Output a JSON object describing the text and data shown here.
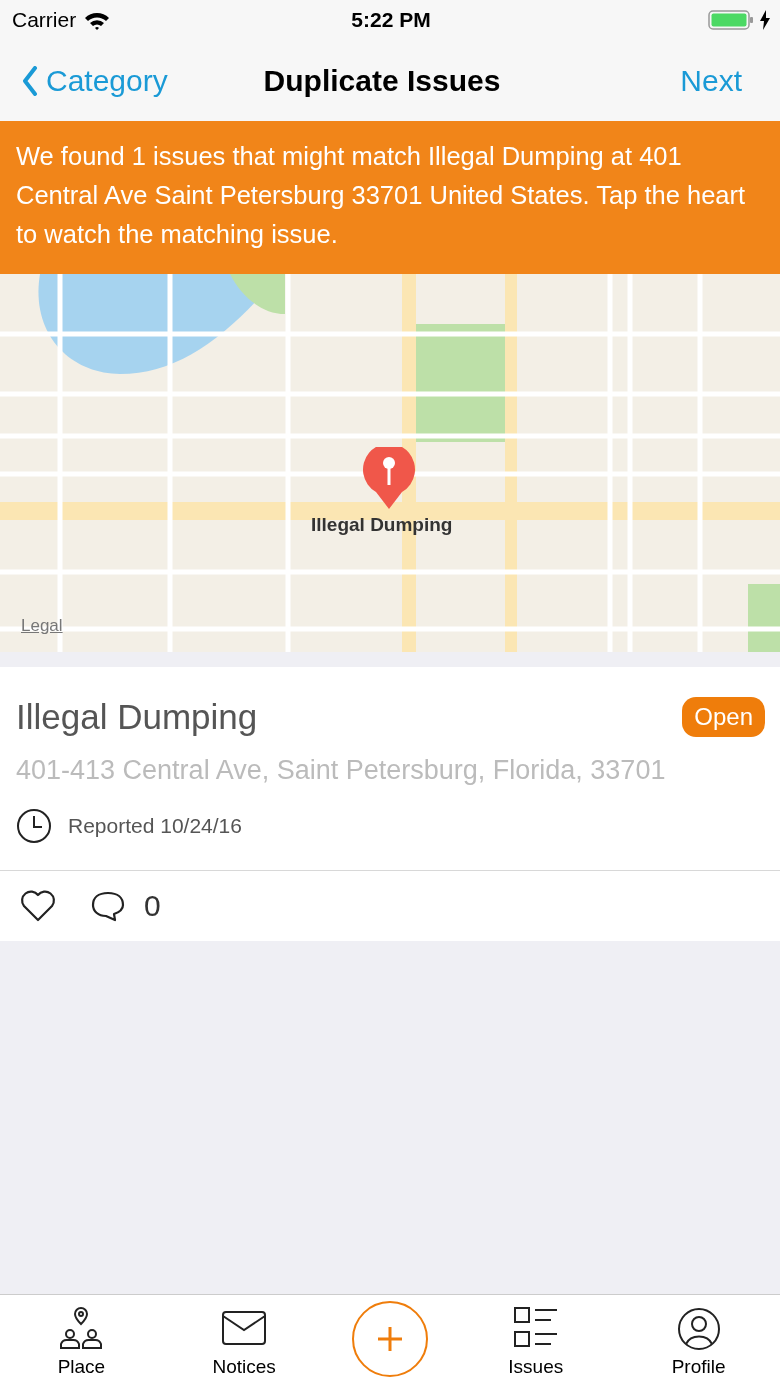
{
  "status_bar": {
    "carrier": "Carrier",
    "time": "5:22 PM"
  },
  "nav": {
    "back": "Category",
    "title": "Duplicate Issues",
    "action": "Next"
  },
  "banner": "We found 1 issues that might match Illegal Dumping at 401 Central Ave Saint Petersburg 33701 United States. Tap the heart to watch the matching issue.",
  "map": {
    "kind": "picture",
    "pin_label": "Illegal Dumping",
    "legal_link": "Legal"
  },
  "issue": {
    "title": "Illegal Dumping",
    "status": "Open",
    "address": "401-413 Central Ave, Saint Petersburg, Florida, 33701",
    "reported": "Reported 10/24/16",
    "watched": false,
    "comment_count": "0"
  },
  "tab_bar": [
    {
      "kind": "place",
      "label": "Place"
    },
    {
      "kind": "notices",
      "label": "Notices"
    },
    {
      "kind": "add"
    },
    {
      "kind": "issues",
      "label": "Issues"
    },
    {
      "kind": "profile",
      "label": "Profile"
    }
  ]
}
